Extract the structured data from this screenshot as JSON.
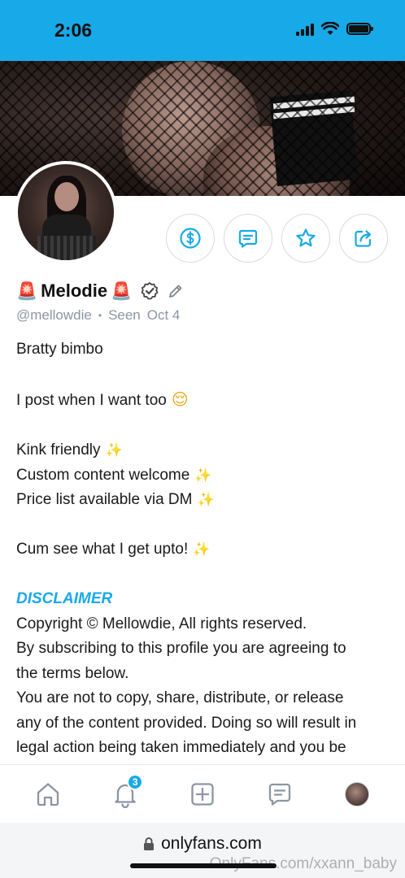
{
  "status_bar": {
    "time": "2:06"
  },
  "profile": {
    "name": "Melodie",
    "handle": "@mellowdie",
    "separator": "•",
    "seen_label": "Seen",
    "seen_date": "Oct 4"
  },
  "bio": {
    "lines": [
      "Bratty bimbo",
      "",
      "I post when I want too",
      "",
      "Kink friendly",
      "Custom content welcome",
      "Price list available via DM",
      "",
      "Cum see what I get upto!",
      "",
      "DISCLAIMER",
      "Copyright © Mellowdie, All rights reserved.",
      "By subscribing to this profile you are agreeing to",
      "the terms below.",
      "You are not to copy, share, distribute, or release",
      "any of the content provided. Doing so will result in",
      "legal action being taken immediately and you be"
    ]
  },
  "nav": {
    "notifications_badge": "3"
  },
  "browser": {
    "url": "onlyfans.com"
  },
  "watermark": "OnlyFans.com/xxann_baby",
  "colors": {
    "accent": "#18a9e8",
    "muted": "#8a96a3"
  },
  "icons": {
    "tip": "dollar-circle-icon",
    "message": "message-icon",
    "favorite": "star-icon",
    "share": "share-icon",
    "home": "home-icon",
    "notifications": "bell-icon",
    "add": "plus-square-icon",
    "chats": "chat-icon",
    "lock": "lock-icon"
  }
}
